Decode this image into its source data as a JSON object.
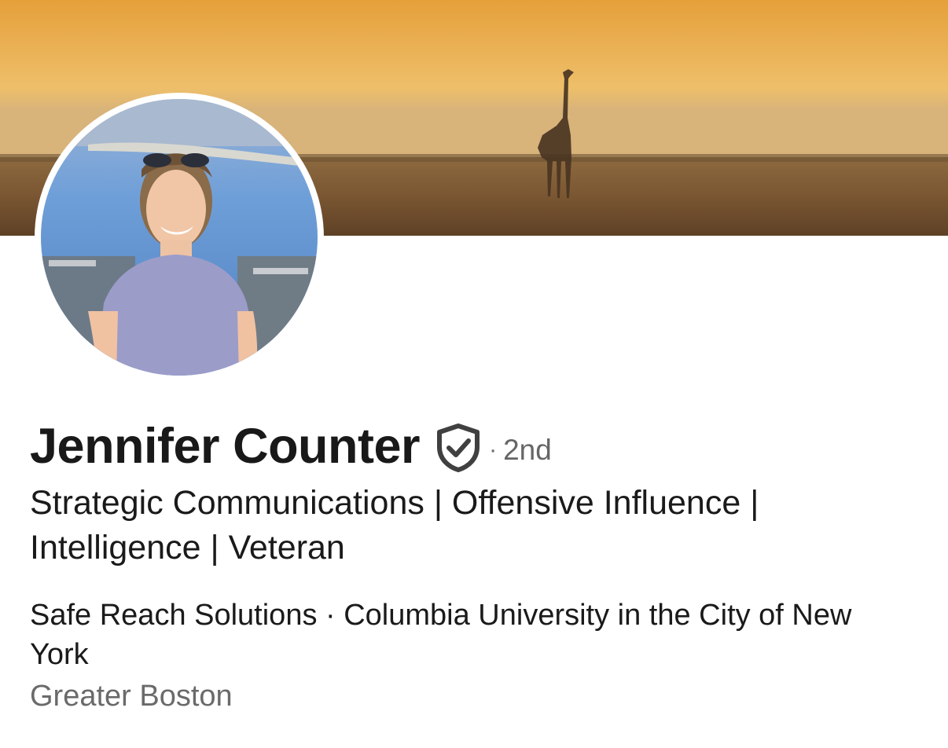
{
  "profile": {
    "name": "Jennifer Counter",
    "verified_icon": "verified-shield-icon",
    "connection_separator": "·",
    "connection_degree": "2nd",
    "headline": "Strategic Communications | Offensive Influence | Intelligence | Veteran",
    "company_education": "Safe Reach Solutions · Columbia University in the City of New York",
    "location": "Greater Boston"
  },
  "colors": {
    "name_text": "#191919",
    "secondary_text": "#666666",
    "banner_sky": "#eab55e",
    "banner_ground": "#6b4b2c"
  }
}
